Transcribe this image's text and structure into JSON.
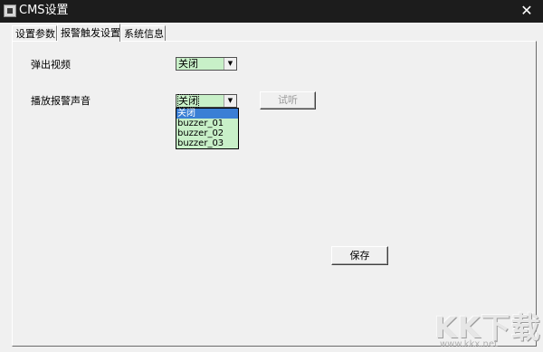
{
  "window": {
    "title": "CMS设置",
    "close_glyph": "✕"
  },
  "tabs": [
    {
      "label": "设置参数",
      "active": false
    },
    {
      "label": "报警触发设置",
      "active": true
    },
    {
      "label": "系统信息",
      "active": false
    }
  ],
  "popup_video": {
    "label": "弹出视频",
    "value": "关闭"
  },
  "alarm_sound": {
    "label": "播放报警声音",
    "value": "关闭",
    "options": [
      "关闭",
      "buzzer_01",
      "buzzer_02",
      "buzzer_03"
    ],
    "selected_index": 0,
    "test_label": "试听"
  },
  "save_label": "保存",
  "watermark": {
    "text": "KK下载",
    "url": "www.kkx.net"
  },
  "colors": {
    "titlebar": "#1c1c1c",
    "combo_bg": "#c8f0c8",
    "selection": "#3a7fd5"
  }
}
